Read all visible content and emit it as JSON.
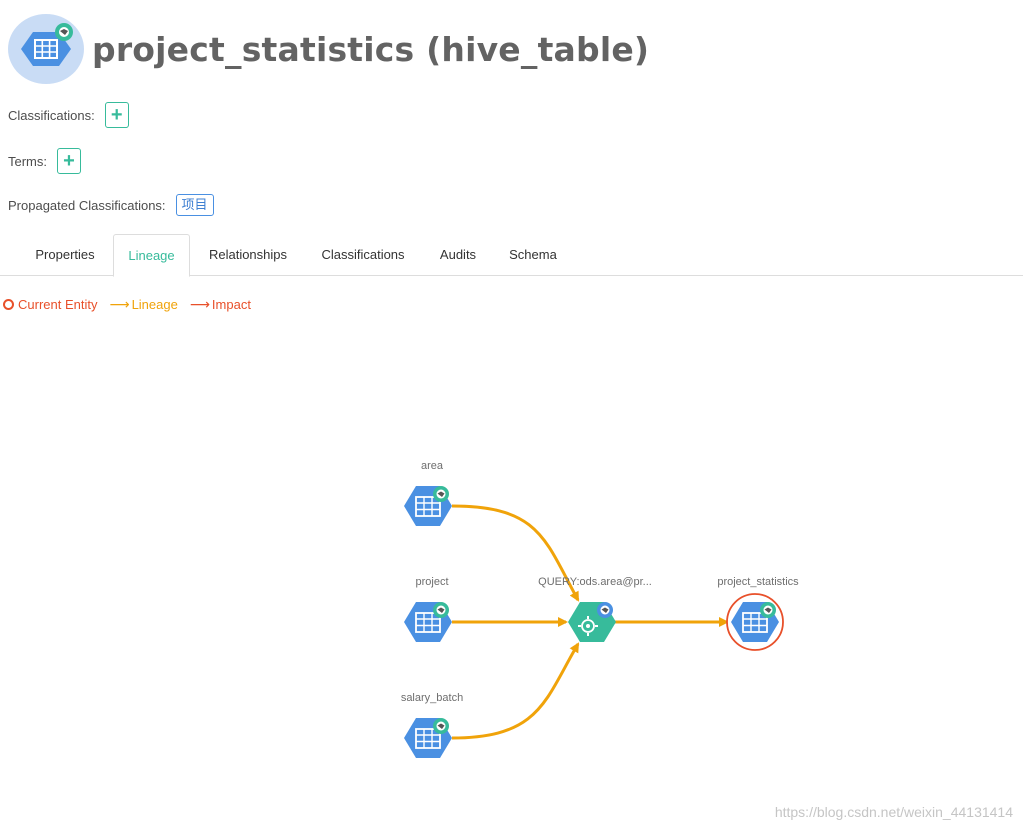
{
  "entity": {
    "title": "project_statistics (hive_table)",
    "icon": "hive-table-icon"
  },
  "meta": {
    "classifications_label": "Classifications:",
    "terms_label": "Terms:",
    "propagated_label": "Propagated Classifications:",
    "propagated_tag": "项目",
    "add_symbol": "+"
  },
  "tabs": [
    {
      "label": "Properties",
      "active": false
    },
    {
      "label": "Lineage",
      "active": true
    },
    {
      "label": "Relationships",
      "active": false
    },
    {
      "label": "Classifications",
      "active": false
    },
    {
      "label": "Audits",
      "active": false
    },
    {
      "label": "Schema",
      "active": false
    }
  ],
  "legend": {
    "current": "Current Entity",
    "lineage": "Lineage",
    "impact": "Impact",
    "arrow_symbol": "⟶"
  },
  "colors": {
    "accent": "#37bb9b",
    "lineage": "#f0a30a",
    "impact": "#e8502a",
    "table_node": "#4a90e2",
    "process_node": "#37bb9b"
  },
  "graph": {
    "nodes": [
      {
        "label": "area",
        "kind": "table"
      },
      {
        "label": "project",
        "kind": "table"
      },
      {
        "label": "salary_batch",
        "kind": "table"
      },
      {
        "label": "QUERY:ods.area@pr...",
        "kind": "process"
      },
      {
        "label": "project_statistics",
        "kind": "table",
        "current": true
      }
    ]
  },
  "watermark": "https://blog.csdn.net/weixin_44131414"
}
